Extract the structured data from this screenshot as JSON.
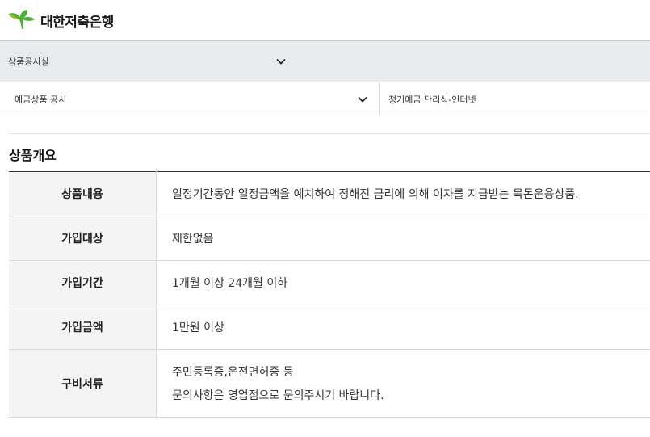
{
  "header": {
    "brand": "대한저축은행",
    "logo_icon": "ginkgo-leaf-icon",
    "logo_color": "#4caf3a"
  },
  "menubar": {
    "label": "상품공시실"
  },
  "selectors": {
    "category": "예금상품 공시",
    "product": "정기예금 단리식-인터넷"
  },
  "section": {
    "title": "상품개요"
  },
  "table": {
    "rows": [
      {
        "header": "상품내용",
        "value": "일정기간동안 일정금액을 예치하여 정해진 금리에 의해 이자를 지급받는 목돈운용상품."
      },
      {
        "header": "가입대상",
        "value": "제한없음"
      },
      {
        "header": "가입기간",
        "value": "1개월 이상 24개월 이하"
      },
      {
        "header": "가입금액",
        "value": "1만원 이상"
      },
      {
        "header": "구비서류",
        "value": "주민등록증,운전면허증 등",
        "value2": "문의사항은 영업점으로 문의주시기 바랍니다."
      }
    ]
  }
}
